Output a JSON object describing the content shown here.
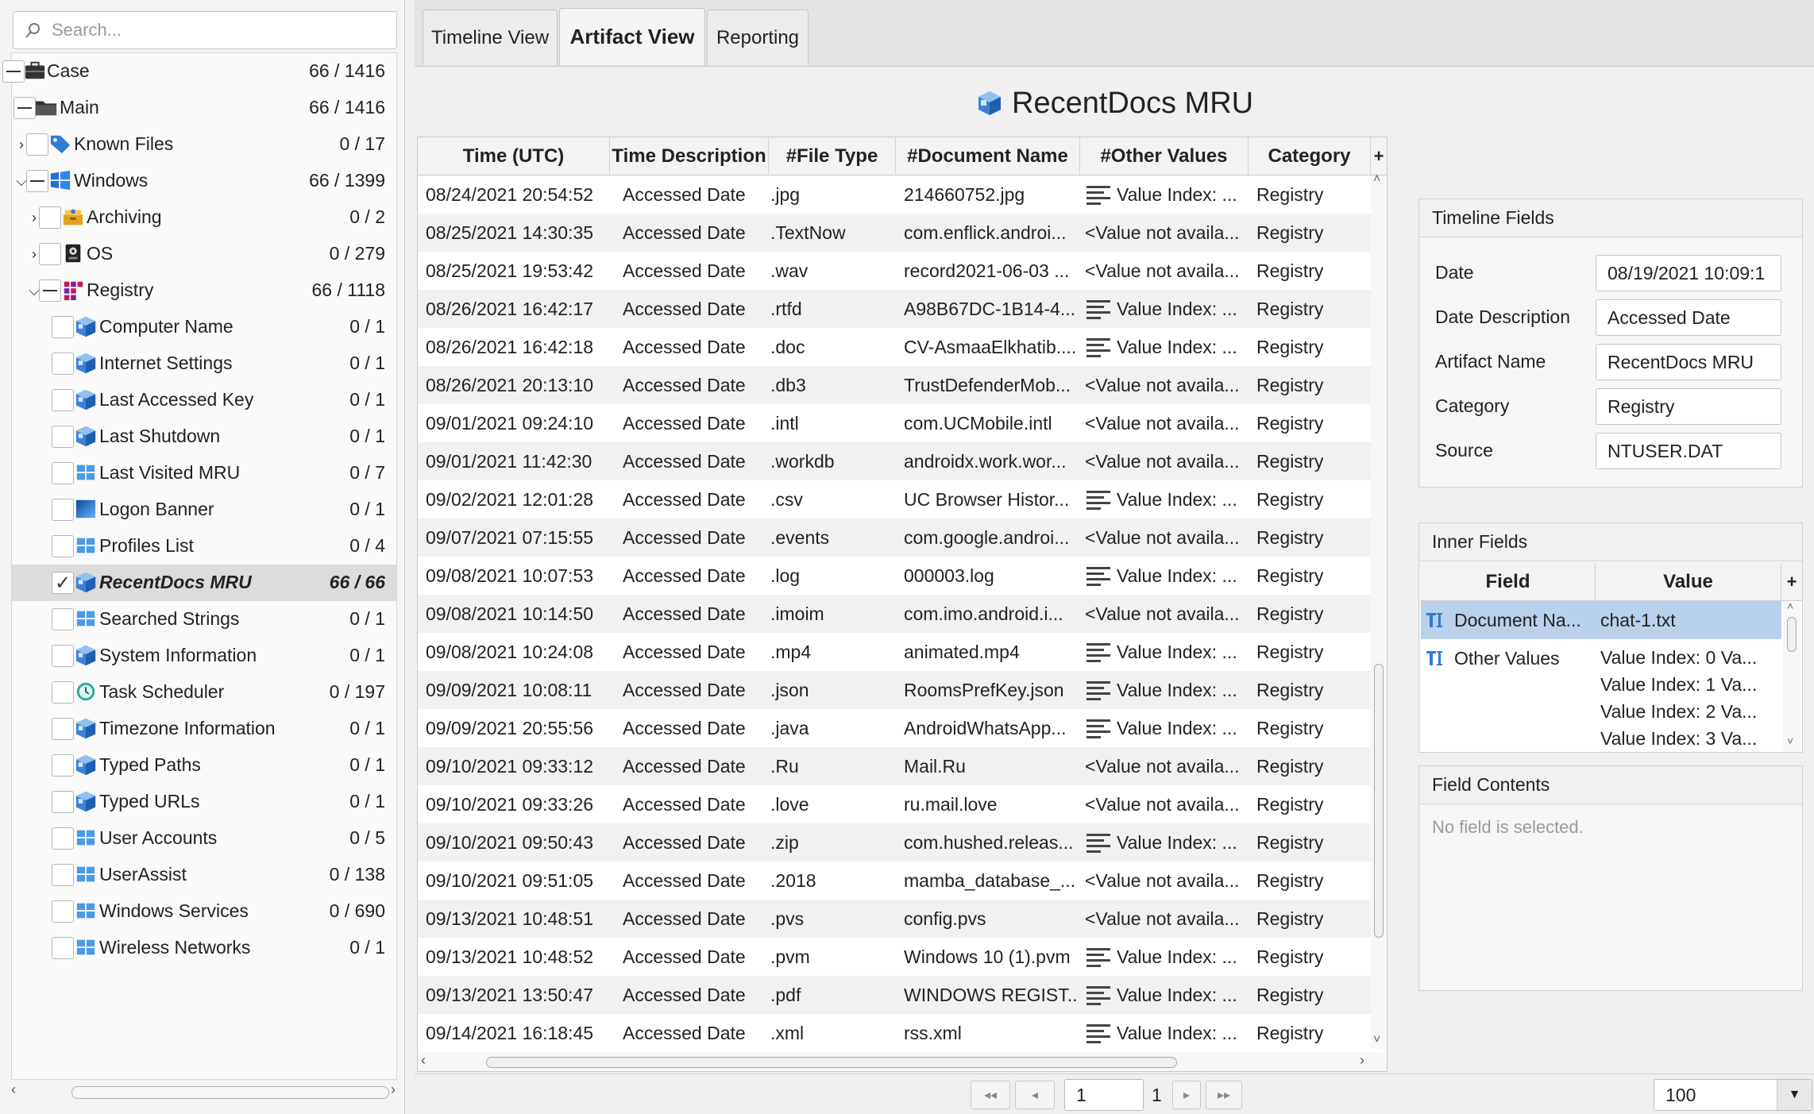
{
  "search": {
    "placeholder": "Search..."
  },
  "tree": [
    {
      "label": "Case",
      "count": "66 / 1416",
      "icon": "briefcase-icon",
      "check": "minus"
    },
    {
      "label": "Main",
      "count": "66 / 1416",
      "icon": "folder-icon",
      "check": "minus"
    },
    {
      "label": "Known Files",
      "count": "0 / 17",
      "icon": "tag-icon",
      "check": "empty",
      "arrow": "right"
    },
    {
      "label": "Windows",
      "count": "66 / 1399",
      "icon": "windows-icon",
      "check": "minus",
      "arrow": "down"
    },
    {
      "label": "Archiving",
      "count": "0 / 2",
      "icon": "archive-icon",
      "check": "empty",
      "arrow": "right"
    },
    {
      "label": "OS",
      "count": "0 / 279",
      "icon": "os-icon",
      "check": "empty",
      "arrow": "right"
    },
    {
      "label": "Registry",
      "count": "66 / 1118",
      "icon": "registry-icon",
      "check": "minus",
      "arrow": "down"
    },
    {
      "label": "Computer Name",
      "count": "0 / 1",
      "icon": "registry-cube-icon",
      "check": "empty"
    },
    {
      "label": "Internet Settings",
      "count": "0 / 1",
      "icon": "registry-cube-icon",
      "check": "empty"
    },
    {
      "label": "Last Accessed Key",
      "count": "0 / 1",
      "icon": "registry-cube-icon",
      "check": "empty"
    },
    {
      "label": "Last Shutdown",
      "count": "0 / 1",
      "icon": "registry-cube-icon",
      "check": "empty"
    },
    {
      "label": "Last Visited MRU",
      "count": "0 / 7",
      "icon": "windows-logo-icon",
      "check": "empty"
    },
    {
      "label": "Logon Banner",
      "count": "0 / 1",
      "icon": "banner-icon",
      "check": "empty"
    },
    {
      "label": "Profiles List",
      "count": "0 / 4",
      "icon": "windows-logo-icon",
      "check": "empty"
    },
    {
      "label": "RecentDocs MRU",
      "count": "66 / 66",
      "icon": "registry-cube-icon",
      "check": "checked",
      "selected": true
    },
    {
      "label": "Searched Strings",
      "count": "0 / 1",
      "icon": "windows-logo-icon",
      "check": "empty"
    },
    {
      "label": "System Information",
      "count": "0 / 1",
      "icon": "registry-cube-icon",
      "check": "empty"
    },
    {
      "label": "Task Scheduler",
      "count": "0 / 197",
      "icon": "clock-icon",
      "check": "empty"
    },
    {
      "label": "Timezone Information",
      "count": "0 / 1",
      "icon": "registry-cube-icon",
      "check": "empty"
    },
    {
      "label": "Typed Paths",
      "count": "0 / 1",
      "icon": "registry-cube-icon",
      "check": "empty"
    },
    {
      "label": "Typed URLs",
      "count": "0 / 1",
      "icon": "registry-cube-icon",
      "check": "empty"
    },
    {
      "label": "User Accounts",
      "count": "0 / 5",
      "icon": "windows-logo-icon",
      "check": "empty"
    },
    {
      "label": "UserAssist",
      "count": "0 / 138",
      "icon": "windows-logo-icon",
      "check": "empty"
    },
    {
      "label": "Windows Services",
      "count": "0 / 690",
      "icon": "windows-logo-icon",
      "check": "empty"
    },
    {
      "label": "Wireless Networks",
      "count": "0 / 1",
      "icon": "windows-logo-icon",
      "check": "empty"
    }
  ],
  "tabs": [
    {
      "label": "Timeline View",
      "active": false
    },
    {
      "label": "Artifact View",
      "active": true
    },
    {
      "label": "Reporting",
      "active": false
    }
  ],
  "artifact_title": "RecentDocs MRU",
  "grid": {
    "columns": [
      "Time (UTC)",
      "Time Description",
      "#File Type",
      "#Document Name",
      "#Other Values",
      "Category"
    ],
    "add_column": "+",
    "rows": [
      [
        "08/24/2021 20:54:52",
        "Accessed Date",
        ".jpg",
        "214660752.jpg",
        "Value Index: ...",
        "Registry",
        true
      ],
      [
        "08/25/2021 14:30:35",
        "Accessed Date",
        ".TextNow",
        "com.enflick.androi...",
        "<Value not availa...",
        "Registry",
        false
      ],
      [
        "08/25/2021 19:53:42",
        "Accessed Date",
        ".wav",
        "record2021-06-03 ...",
        "<Value not availa...",
        "Registry",
        false
      ],
      [
        "08/26/2021 16:42:17",
        "Accessed Date",
        ".rtfd",
        "A98B67DC-1B14-4...",
        "Value Index: ...",
        "Registry",
        true
      ],
      [
        "08/26/2021 16:42:18",
        "Accessed Date",
        ".doc",
        "CV-AsmaaElkhatib....",
        "Value Index: ...",
        "Registry",
        true
      ],
      [
        "08/26/2021 20:13:10",
        "Accessed Date",
        ".db3",
        "TrustDefenderMob...",
        "<Value not availa...",
        "Registry",
        false
      ],
      [
        "09/01/2021 09:24:10",
        "Accessed Date",
        ".intl",
        "com.UCMobile.intl",
        "<Value not availa...",
        "Registry",
        false
      ],
      [
        "09/01/2021 11:42:30",
        "Accessed Date",
        ".workdb",
        "androidx.work.wor...",
        "<Value not availa...",
        "Registry",
        false
      ],
      [
        "09/02/2021 12:01:28",
        "Accessed Date",
        ".csv",
        "UC Browser Histor...",
        "Value Index: ...",
        "Registry",
        true
      ],
      [
        "09/07/2021 07:15:55",
        "Accessed Date",
        ".events",
        "com.google.androi...",
        "<Value not availa...",
        "Registry",
        false
      ],
      [
        "09/08/2021 10:07:53",
        "Accessed Date",
        ".log",
        "000003.log",
        "Value Index: ...",
        "Registry",
        true
      ],
      [
        "09/08/2021 10:14:50",
        "Accessed Date",
        ".imoim",
        "com.imo.android.i...",
        "<Value not availa...",
        "Registry",
        false
      ],
      [
        "09/08/2021 10:24:08",
        "Accessed Date",
        ".mp4",
        "animated.mp4",
        "Value Index: ...",
        "Registry",
        true
      ],
      [
        "09/09/2021 10:08:11",
        "Accessed Date",
        ".json",
        "RoomsPrefKey.json",
        "Value Index: ...",
        "Registry",
        true
      ],
      [
        "09/09/2021 20:55:56",
        "Accessed Date",
        ".java",
        "AndroidWhatsApp...",
        "Value Index: ...",
        "Registry",
        true
      ],
      [
        "09/10/2021 09:33:12",
        "Accessed Date",
        ".Ru",
        "Mail.Ru",
        "<Value not availa...",
        "Registry",
        false
      ],
      [
        "09/10/2021 09:33:26",
        "Accessed Date",
        ".love",
        "ru.mail.love",
        "<Value not availa...",
        "Registry",
        false
      ],
      [
        "09/10/2021 09:50:43",
        "Accessed Date",
        ".zip",
        "com.hushed.releas...",
        "Value Index: ...",
        "Registry",
        true
      ],
      [
        "09/10/2021 09:51:05",
        "Accessed Date",
        ".2018",
        "mamba_database_...",
        "<Value not availa...",
        "Registry",
        false
      ],
      [
        "09/13/2021 10:48:51",
        "Accessed Date",
        ".pvs",
        "config.pvs",
        "<Value not availa...",
        "Registry",
        false
      ],
      [
        "09/13/2021 10:48:52",
        "Accessed Date",
        ".pvm",
        "Windows 10 (1).pvm",
        "Value Index: ...",
        "Registry",
        true
      ],
      [
        "09/13/2021 13:50:47",
        "Accessed Date",
        ".pdf",
        "WINDOWS REGIST....",
        "Value Index: ...",
        "Registry",
        true
      ],
      [
        "09/14/2021 16:18:45",
        "Accessed Date",
        ".xml",
        "rss.xml",
        "Value Index: ...",
        "Registry",
        true
      ]
    ]
  },
  "pager": {
    "page": "1",
    "total": "1",
    "page_size": "100"
  },
  "timeline_fields": {
    "title": "Timeline Fields",
    "fields": [
      {
        "label": "Date",
        "value": "08/19/2021 10:09:1"
      },
      {
        "label": "Date Description",
        "value": "Accessed Date"
      },
      {
        "label": "Artifact Name",
        "value": "RecentDocs MRU"
      },
      {
        "label": "Category",
        "value": "Registry"
      },
      {
        "label": "Source",
        "value": "NTUSER.DAT"
      }
    ]
  },
  "inner_fields": {
    "title": "Inner Fields",
    "columns": [
      "Field",
      "Value"
    ],
    "add_column": "+",
    "rows": [
      {
        "field": "Document Na...",
        "values": [
          "chat-1.txt"
        ],
        "selected": true
      },
      {
        "field": "Other Values",
        "values": [
          "Value Index: 0  Va...",
          "Value Index: 1  Va...",
          "Value Index: 2  Va...",
          "Value Index: 3  Va..."
        ],
        "selected": false
      }
    ]
  },
  "field_contents": {
    "title": "Field Contents",
    "placeholder": "No field is selected."
  },
  "colors": {
    "selected_row": "#b9d1ea",
    "registry_blue": "#2f7bd6"
  }
}
